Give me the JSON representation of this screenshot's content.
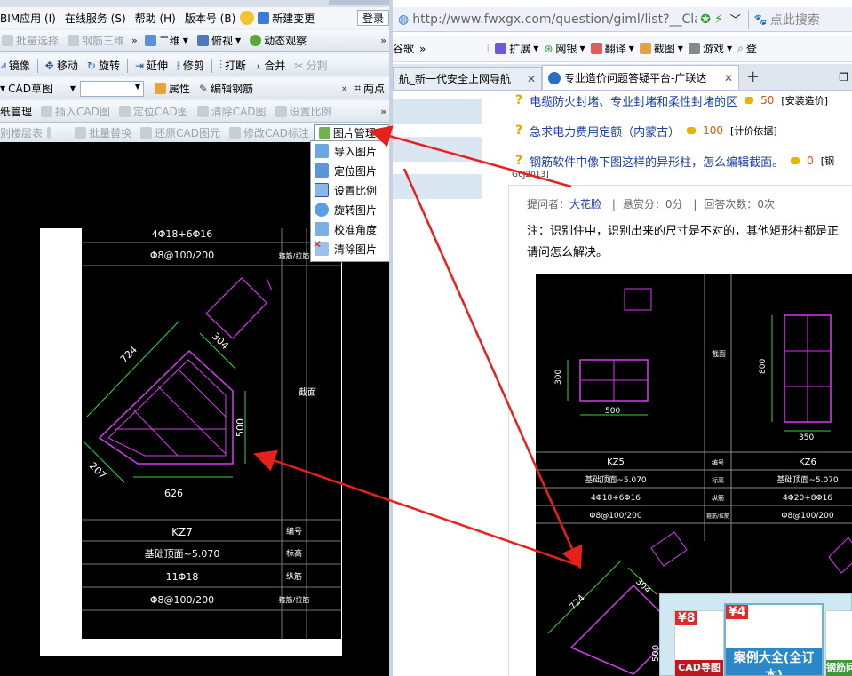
{
  "cad": {
    "menubar": {
      "items": [
        "BIM应用 (I)",
        "在线服务 (S)",
        "帮助 (H)",
        "版本号 (B)"
      ],
      "new_change": "新建变更",
      "login": "登录"
    },
    "toolbar1": {
      "batch_select": "批量选择",
      "rebar_3d": "钢筋三维",
      "view_2d": "二维",
      "top_view": "俯视",
      "dynamic_observe": "动态观察"
    },
    "toolbar2": {
      "mirror": "镜像",
      "move": "移动",
      "rotate": "旋转",
      "extend": "延伸",
      "trim": "修剪",
      "break": "打断",
      "merge": "合并",
      "split": "分割"
    },
    "toolbar3": {
      "cad_sketch": "CAD草图",
      "property": "属性",
      "edit_rebar": "编辑钢筋",
      "two_point": "两点"
    },
    "toolbar4": {
      "drawing_mgmt": "纸管理",
      "insert_cad": "插入CAD图",
      "locate_cad": "定位CAD图",
      "clear_cad": "清除CAD图",
      "set_scale": "设置比例"
    },
    "toolbar5": {
      "floor_table": "别楼层表",
      "batch_replace": "批量替换",
      "restore_cad": "还原CAD图元",
      "modify_annotation": "修改CAD标注",
      "picture_mgmt": "图片管理"
    },
    "picture_menu": [
      "导入图片",
      "定位图片",
      "设置比例",
      "旋转图片",
      "校准角度",
      "清除图片"
    ],
    "drawing": {
      "top_rows": [
        "4Φ18+6Φ16",
        "Φ8@100/200"
      ],
      "top_right": [
        "",
        "箍筋/拉筋"
      ],
      "side_label": "截面",
      "dims": {
        "d724": "724",
        "d304": "304",
        "d500": "500",
        "d207": "207",
        "d626": "626"
      },
      "table": [
        {
          "left": "KZ7",
          "right": "编号"
        },
        {
          "left": "基础顶面~5.070",
          "right": "标高"
        },
        {
          "left": "11Φ18",
          "right": "纵筋"
        },
        {
          "left": "Φ8@100/200",
          "right": "箍筋/拉筋"
        }
      ]
    },
    "colors": {
      "drawing_bg": "#000000",
      "magenta": "#d63cf0",
      "green": "#3cd23c",
      "red": "#e8201c"
    }
  },
  "browser": {
    "url": "http://www.fwxgx.com/question/giml/list?__Class",
    "search_placeholder": "点此搜索",
    "bookmarks": {
      "google": "谷歌",
      "extend": "扩展",
      "netbank": "网银",
      "translate": "翻译",
      "screenshot": "截图",
      "games": "游戏",
      "login": "登"
    },
    "tabs": [
      "航_新一代安全上网导航",
      "专业造价问题答疑平台-广联达"
    ],
    "questions": [
      {
        "title": "电缆防火封堵、专业封堵和柔性封堵的区",
        "points": "50",
        "tag": "[安装造价]"
      },
      {
        "title": "急求电力费用定额（内蒙古）",
        "points": "100",
        "tag": "[计价依据]"
      },
      {
        "title": "钢筋软件中像下图这样的异形柱，怎么编辑截面。",
        "points": "0",
        "tag": "[钢"
      }
    ],
    "question_code": "G6J2013]",
    "asker_label": "提问者：",
    "asker": "大花脸",
    "reward": "悬赏分：0分",
    "answers": "回答次数：0次",
    "note_line1": "注：识别住中，识别出来的尺寸是不对的，其他矩形柱都是正",
    "note_line2": "请问怎么解决。",
    "drawing": {
      "kz5": {
        "d300": "300",
        "d500": "500",
        "name": "KZ5",
        "elev": "基础顶面~5.070",
        "rebar": "4Φ18+6Φ16",
        "stirrup": "Φ8@100/200"
      },
      "kz6": {
        "d800": "800",
        "d350": "350",
        "name": "KZ6",
        "elev": "基础顶面~5.070",
        "rebar": "4Φ20+8Φ16",
        "stirrup": "Φ8@100/200"
      },
      "labels": {
        "section": "截面",
        "number": "编号",
        "elevation": "标高",
        "rebar": "纵筋",
        "stirrup": "箍筋/拉筋"
      },
      "d724": "724",
      "d304": "304",
      "d500": "500"
    },
    "ads": {
      "ad1_badge": "¥8",
      "ad1_text": "CAD导图全解",
      "ad2_badge": "¥4",
      "ad2_text": "案例大全(全订本)",
      "ad3_text": "钢筋问题全集"
    }
  }
}
